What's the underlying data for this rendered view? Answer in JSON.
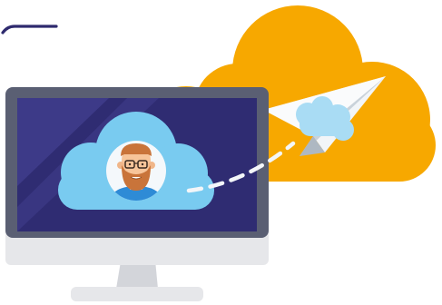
{
  "illustration": {
    "icons": {
      "accent_stroke": "corner-accent-line",
      "background_cloud": "orange-cloud-icon",
      "paper_plane": "paper-plane-icon",
      "plane_cloud": "small-cloud-icon",
      "monitor": "desktop-monitor-icon",
      "screen_cloud": "screen-cloud-icon",
      "avatar": "bearded-man-avatar-icon",
      "dashed_path": "send-path-dashes"
    },
    "colors": {
      "orange_cloud": "#F7A800",
      "accent_line": "#2E2A6E",
      "monitor_frame": "#5A5F73",
      "screen": "#2F2C72",
      "screen_glare": "#3D3A88",
      "screen_cloud": "#79CBF0",
      "plane_light": "#EEF2F5",
      "plane_shade": "#C9D2DA",
      "plane_cloud": "#A9DCF4",
      "monitor_base": "#E6E7EA",
      "stand": "#D3D5DA",
      "avatar_bg": "#F4F8FB",
      "hair": "#C9743A",
      "skin": "#F7C59A",
      "shirt": "#2E8BD6",
      "dash": "#F3F6F9"
    }
  }
}
